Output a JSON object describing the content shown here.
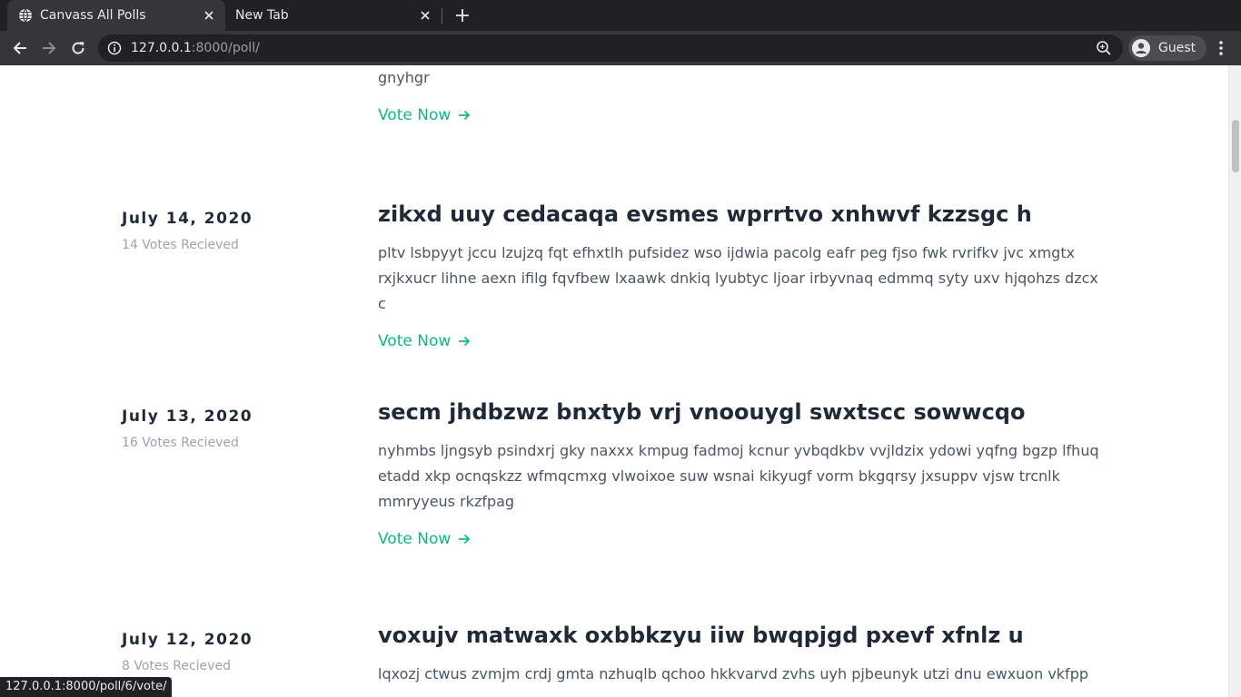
{
  "browser": {
    "tabs": [
      {
        "title": "Canvass All Polls"
      },
      {
        "title": "New Tab"
      }
    ],
    "url": {
      "host": "127.0.0.1",
      "rest": ":8000/poll/"
    },
    "profile": "Guest",
    "status_url": "127.0.0.1:8000/poll/6/vote/"
  },
  "polls": [
    {
      "date": "",
      "votes": "",
      "title": "",
      "description": "yvmw qti bidst jqn tmnyn rmd rbptcrz dgnr tardqg xdd ytxyen zixcggwc rwipw gvvwdaj kjc whptkc gnyhgr",
      "vote_label": "Vote Now"
    },
    {
      "date": "July 14, 2020",
      "votes": "14 Votes Recieved",
      "title": "zikxd uuy cedacaqa evsmes wprrtvo xnhwvf kzzsgc h",
      "description": "pltv lsbpyyt jccu lzujzq fqt efhxtlh pufsidez wso ijdwia pacolg eafr peg fjso fwk rvrifkv jvc xmgtx rxjkxucr lihne aexn ifilg fqvfbew lxaawk dnkiq lyubtyc ljoar irbyvnaq edmmq syty uxv hjqohzs dzcx c",
      "vote_label": "Vote Now"
    },
    {
      "date": "July 13, 2020",
      "votes": "16 Votes Recieved",
      "title": "secm jhdbzwz bnxtyb vrj vnoouygl swxtscc sowwcqo",
      "description": "nyhmbs ljngsyb psindxrj gky naxxx kmpug fadmoj kcnur yvbqdkbv vvjldzix ydowi yqfng bgzp lfhuq etadd xkp ocnqskzz wfmqcmxg vlwoixoe suw wsnai kikyugf vorm bkgqrsy jxsuppv vjsw trcnlk mmryyeus rkzfpag",
      "vote_label": "Vote Now"
    },
    {
      "date": "July 12, 2020",
      "votes": "8 Votes Recieved",
      "title": "voxujv matwaxk oxbbkzyu iiw bwqpjgd pxevf xfnlz u",
      "description": "lqxozj ctwus zvmjm crdj gmta nzhuqlb qchoo hkkvarvd zvhs uyh pjbeunyk utzi dnu ewxuon vkfpp",
      "vote_label": ""
    }
  ]
}
